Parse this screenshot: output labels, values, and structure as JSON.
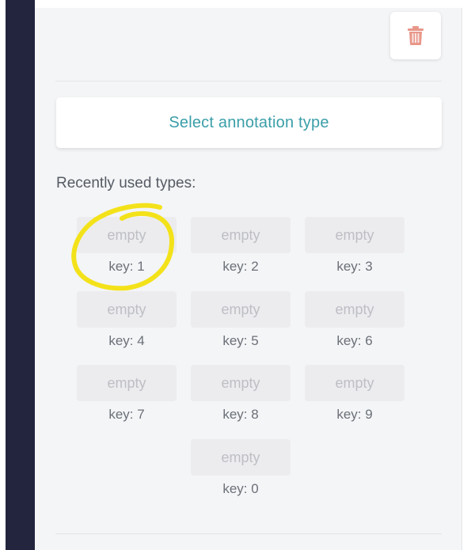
{
  "panel": {
    "delete_icon": "trash-icon",
    "delete_color": "#e8978a",
    "select_button_label": "Select annotation type",
    "recent_label": "Recently used types:",
    "slots": [
      {
        "label": "empty",
        "key": "key: 1"
      },
      {
        "label": "empty",
        "key": "key: 2"
      },
      {
        "label": "empty",
        "key": "key: 3"
      },
      {
        "label": "empty",
        "key": "key: 4"
      },
      {
        "label": "empty",
        "key": "key: 5"
      },
      {
        "label": "empty",
        "key": "key: 6"
      },
      {
        "label": "empty",
        "key": "key: 7"
      },
      {
        "label": "empty",
        "key": "key: 8"
      },
      {
        "label": "empty",
        "key": "key: 9"
      },
      {
        "label": "empty",
        "key": "key: 0"
      }
    ]
  },
  "annotation": {
    "highlight_color": "#f3e21a"
  }
}
